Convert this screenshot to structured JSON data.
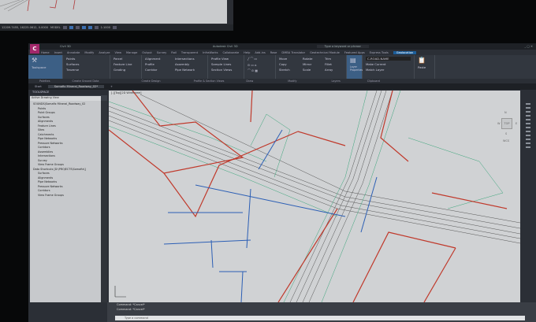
{
  "background_window": {
    "status_coords": "12209.7455, 16225.0612, 0.0000",
    "model_label": "MODEL",
    "scale": "1:1000"
  },
  "window": {
    "title": "Civil 3D",
    "app_icon": "C",
    "file_title": "Autodesk Civil 3D",
    "search_placeholder": "Type a keyword or phrase"
  },
  "ribbon_tabs": [
    "Home",
    "Insert",
    "Annotate",
    "Modify",
    "Analyze",
    "View",
    "Manage",
    "Output",
    "Survey",
    "Rail",
    "Transparent",
    "InfraWorks",
    "Collaborate",
    "Help",
    "Add-ins",
    "Rose",
    "DMBA Translator",
    "Geotechnical Module",
    "Featured Apps",
    "Express Tools",
    "Geolocation"
  ],
  "active_tab": "Geolocation",
  "ribbon": {
    "palettes": {
      "toolspace": "Toolspace",
      "label": "Palettes"
    },
    "ground": {
      "items": [
        "Points",
        "Surfaces",
        "Traverse"
      ],
      "label": "Create Ground Data"
    },
    "design": {
      "items": [
        "Parcel",
        "Feature Line",
        "Grading",
        "Alignment",
        "Profile",
        "Corridor",
        "Intersections",
        "Assembly",
        "Pipe Network"
      ],
      "label": "Create Design"
    },
    "profile": {
      "items": [
        "Profile View",
        "Sample Lines",
        "Section Views"
      ],
      "label": "Profile & Section Views"
    },
    "draw": {
      "label": "Draw"
    },
    "modify": {
      "items": [
        "Move",
        "Copy",
        "Stretch",
        "Rotate",
        "Mirror",
        "Scale",
        "Trim",
        "Fillet",
        "Array"
      ],
      "label": "Modify"
    },
    "layers": {
      "layer_properties": "Layer Properties",
      "current_layer": "C-ROAD-NAME",
      "items": [
        "Make Current",
        "Match Layer"
      ],
      "label": "Layers"
    },
    "clipboard": {
      "paste": "Paste",
      "label": "Clipboard"
    }
  },
  "doc_tabs": [
    "Start",
    "Somafix Mineral_Roadway_02*"
  ],
  "toolspace": {
    "title": "TOOLSPACE",
    "view": "Active Drawing View",
    "items": [
      "SOUNDS(Somafix Mineral_Roadway_02",
      "Points",
      "Point Groups",
      "Surfaces",
      "Alignments",
      "Feature Lines",
      "Sites",
      "Catchments",
      "Pipe Networks",
      "Pressure Networks",
      "Corridors",
      "Assemblies",
      "Intersections",
      "Survey",
      "View Frame Groups",
      "Data Shortcuts [D:\\PROJECTS\\Somafix\\]",
      "Surfaces",
      "Alignments",
      "Pipe Networks",
      "Pressure Networks",
      "Corridors",
      "View Frame Groups"
    ]
  },
  "viewport": {
    "label": "[-][Top][2D Wireframe]",
    "viewcube": {
      "top": "TOP",
      "n": "N",
      "s": "S",
      "e": "E",
      "w": "W",
      "wcs": "WCS"
    }
  },
  "command": {
    "history": [
      "Command: *Cancel*",
      "Command: *Cancel*"
    ],
    "placeholder": "Type a command"
  },
  "colors": {
    "canvas": "#d0d2d4",
    "red": "#c0392b",
    "blue": "#2c5fb5",
    "green": "#3aa57a",
    "accent": "#1c5e9a"
  }
}
